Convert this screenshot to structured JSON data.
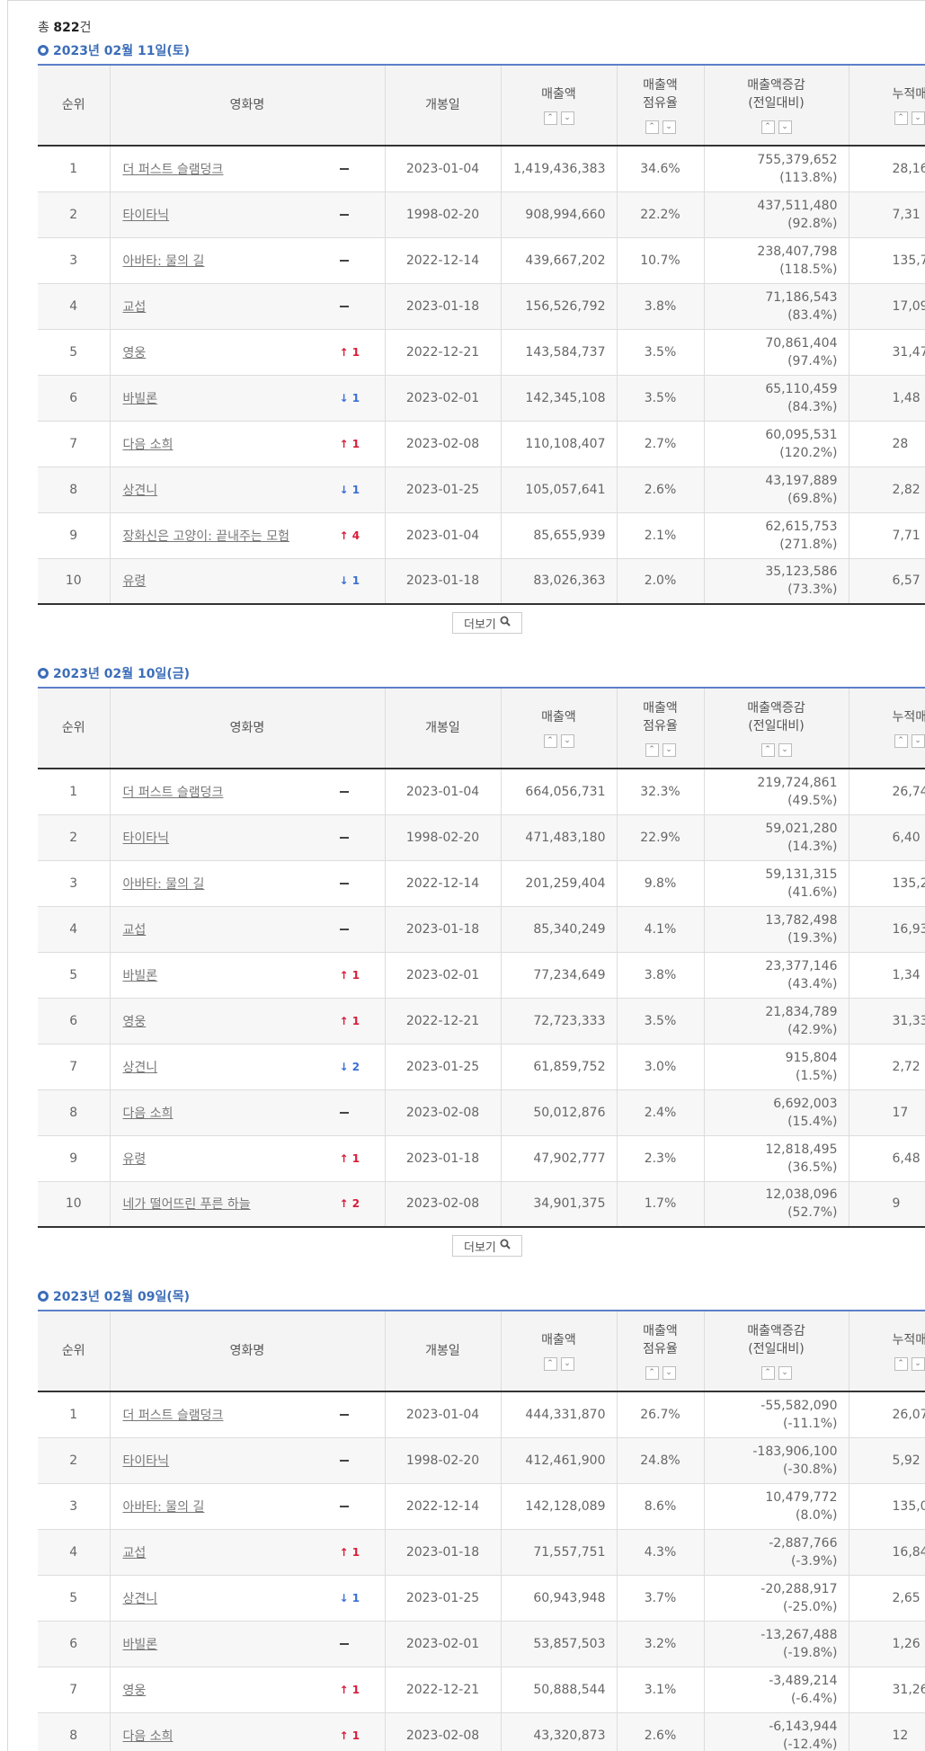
{
  "summary": {
    "prefix": "총 ",
    "count": "822",
    "suffix": "건"
  },
  "headers": {
    "rank": "순위",
    "title": "영화명",
    "opening": "개봉일",
    "sales": "매출액",
    "share_line1": "매출액",
    "share_line2": "점유율",
    "inc_line1": "매출액증감",
    "inc_line2": "(전일대비)",
    "cum": "누적매출액",
    "sort_up": "⌃",
    "sort_down": "⌄"
  },
  "more_label": "더보기",
  "days": [
    {
      "date": "2023년 02월 11일(토)",
      "rows": [
        {
          "rank": "1",
          "title": "더 퍼스트 슬램덩크",
          "change_dir": "same",
          "change_val": "",
          "open": "2023-01-04",
          "sales": "1,419,436,383",
          "share": "34.6%",
          "inc": "755,379,652",
          "inc_pct": "(113.8%)",
          "cum": "28,16"
        },
        {
          "rank": "2",
          "title": "타이타닉",
          "change_dir": "same",
          "change_val": "",
          "open": "1998-02-20",
          "sales": "908,994,660",
          "share": "22.2%",
          "inc": "437,511,480",
          "inc_pct": "(92.8%)",
          "cum": "7,31"
        },
        {
          "rank": "3",
          "title": "아바타: 물의 길",
          "change_dir": "same",
          "change_val": "",
          "open": "2022-12-14",
          "sales": "439,667,202",
          "share": "10.7%",
          "inc": "238,407,798",
          "inc_pct": "(118.5%)",
          "cum": "135,73"
        },
        {
          "rank": "4",
          "title": "교섭",
          "change_dir": "same",
          "change_val": "",
          "open": "2023-01-18",
          "sales": "156,526,792",
          "share": "3.8%",
          "inc": "71,186,543",
          "inc_pct": "(83.4%)",
          "cum": "17,09"
        },
        {
          "rank": "5",
          "title": "영웅",
          "change_dir": "up",
          "change_val": "1",
          "open": "2022-12-21",
          "sales": "143,584,737",
          "share": "3.5%",
          "inc": "70,861,404",
          "inc_pct": "(97.4%)",
          "cum": "31,47"
        },
        {
          "rank": "6",
          "title": "바빌론",
          "change_dir": "down",
          "change_val": "1",
          "open": "2023-02-01",
          "sales": "142,345,108",
          "share": "3.5%",
          "inc": "65,110,459",
          "inc_pct": "(84.3%)",
          "cum": "1,48"
        },
        {
          "rank": "7",
          "title": "다음 소희",
          "change_dir": "up",
          "change_val": "1",
          "open": "2023-02-08",
          "sales": "110,108,407",
          "share": "2.7%",
          "inc": "60,095,531",
          "inc_pct": "(120.2%)",
          "cum": "28"
        },
        {
          "rank": "8",
          "title": "상견니",
          "change_dir": "down",
          "change_val": "1",
          "open": "2023-01-25",
          "sales": "105,057,641",
          "share": "2.6%",
          "inc": "43,197,889",
          "inc_pct": "(69.8%)",
          "cum": "2,82"
        },
        {
          "rank": "9",
          "title": "장화신은 고양이: 끝내주는 모험",
          "change_dir": "up",
          "change_val": "4",
          "open": "2023-01-04",
          "sales": "85,655,939",
          "share": "2.1%",
          "inc": "62,615,753",
          "inc_pct": "(271.8%)",
          "cum": "7,71"
        },
        {
          "rank": "10",
          "title": "유령",
          "change_dir": "down",
          "change_val": "1",
          "open": "2023-01-18",
          "sales": "83,026,363",
          "share": "2.0%",
          "inc": "35,123,586",
          "inc_pct": "(73.3%)",
          "cum": "6,57"
        }
      ]
    },
    {
      "date": "2023년 02월 10일(금)",
      "rows": [
        {
          "rank": "1",
          "title": "더 퍼스트 슬램덩크",
          "change_dir": "same",
          "change_val": "",
          "open": "2023-01-04",
          "sales": "664,056,731",
          "share": "32.3%",
          "inc": "219,724,861",
          "inc_pct": "(49.5%)",
          "cum": "26,74"
        },
        {
          "rank": "2",
          "title": "타이타닉",
          "change_dir": "same",
          "change_val": "",
          "open": "1998-02-20",
          "sales": "471,483,180",
          "share": "22.9%",
          "inc": "59,021,280",
          "inc_pct": "(14.3%)",
          "cum": "6,40"
        },
        {
          "rank": "3",
          "title": "아바타: 물의 길",
          "change_dir": "same",
          "change_val": "",
          "open": "2022-12-14",
          "sales": "201,259,404",
          "share": "9.8%",
          "inc": "59,131,315",
          "inc_pct": "(41.6%)",
          "cum": "135,29"
        },
        {
          "rank": "4",
          "title": "교섭",
          "change_dir": "same",
          "change_val": "",
          "open": "2023-01-18",
          "sales": "85,340,249",
          "share": "4.1%",
          "inc": "13,782,498",
          "inc_pct": "(19.3%)",
          "cum": "16,93"
        },
        {
          "rank": "5",
          "title": "바빌론",
          "change_dir": "up",
          "change_val": "1",
          "open": "2023-02-01",
          "sales": "77,234,649",
          "share": "3.8%",
          "inc": "23,377,146",
          "inc_pct": "(43.4%)",
          "cum": "1,34"
        },
        {
          "rank": "6",
          "title": "영웅",
          "change_dir": "up",
          "change_val": "1",
          "open": "2022-12-21",
          "sales": "72,723,333",
          "share": "3.5%",
          "inc": "21,834,789",
          "inc_pct": "(42.9%)",
          "cum": "31,33"
        },
        {
          "rank": "7",
          "title": "상견니",
          "change_dir": "down",
          "change_val": "2",
          "open": "2023-01-25",
          "sales": "61,859,752",
          "share": "3.0%",
          "inc": "915,804",
          "inc_pct": "(1.5%)",
          "cum": "2,72"
        },
        {
          "rank": "8",
          "title": "다음 소희",
          "change_dir": "same",
          "change_val": "",
          "open": "2023-02-08",
          "sales": "50,012,876",
          "share": "2.4%",
          "inc": "6,692,003",
          "inc_pct": "(15.4%)",
          "cum": "17"
        },
        {
          "rank": "9",
          "title": "유령",
          "change_dir": "up",
          "change_val": "1",
          "open": "2023-01-18",
          "sales": "47,902,777",
          "share": "2.3%",
          "inc": "12,818,495",
          "inc_pct": "(36.5%)",
          "cum": "6,48"
        },
        {
          "rank": "10",
          "title": "네가 떨어뜨린 푸른 하늘",
          "change_dir": "up",
          "change_val": "2",
          "open": "2023-02-08",
          "sales": "34,901,375",
          "share": "1.7%",
          "inc": "12,038,096",
          "inc_pct": "(52.7%)",
          "cum": "9"
        }
      ]
    },
    {
      "date": "2023년 02월 09일(목)",
      "rows": [
        {
          "rank": "1",
          "title": "더 퍼스트 슬램덩크",
          "change_dir": "same",
          "change_val": "",
          "open": "2023-01-04",
          "sales": "444,331,870",
          "share": "26.7%",
          "inc": "-55,582,090",
          "inc_pct": "(-11.1%)",
          "cum": "26,07"
        },
        {
          "rank": "2",
          "title": "타이타닉",
          "change_dir": "same",
          "change_val": "",
          "open": "1998-02-20",
          "sales": "412,461,900",
          "share": "24.8%",
          "inc": "-183,906,100",
          "inc_pct": "(-30.8%)",
          "cum": "5,92"
        },
        {
          "rank": "3",
          "title": "아바타: 물의 길",
          "change_dir": "same",
          "change_val": "",
          "open": "2022-12-14",
          "sales": "142,128,089",
          "share": "8.6%",
          "inc": "10,479,772",
          "inc_pct": "(8.0%)",
          "cum": "135,09"
        },
        {
          "rank": "4",
          "title": "교섭",
          "change_dir": "up",
          "change_val": "1",
          "open": "2023-01-18",
          "sales": "71,557,751",
          "share": "4.3%",
          "inc": "-2,887,766",
          "inc_pct": "(-3.9%)",
          "cum": "16,84"
        },
        {
          "rank": "5",
          "title": "상견니",
          "change_dir": "down",
          "change_val": "1",
          "open": "2023-01-25",
          "sales": "60,943,948",
          "share": "3.7%",
          "inc": "-20,288,917",
          "inc_pct": "(-25.0%)",
          "cum": "2,65"
        },
        {
          "rank": "6",
          "title": "바빌론",
          "change_dir": "same",
          "change_val": "",
          "open": "2023-02-01",
          "sales": "53,857,503",
          "share": "3.2%",
          "inc": "-13,267,488",
          "inc_pct": "(-19.8%)",
          "cum": "1,26"
        },
        {
          "rank": "7",
          "title": "영웅",
          "change_dir": "up",
          "change_val": "1",
          "open": "2022-12-21",
          "sales": "50,888,544",
          "share": "3.1%",
          "inc": "-3,489,214",
          "inc_pct": "(-6.4%)",
          "cum": "31,26"
        },
        {
          "rank": "8",
          "title": "다음 소희",
          "change_dir": "up",
          "change_val": "1",
          "open": "2023-02-08",
          "sales": "43,320,873",
          "share": "2.6%",
          "inc": "-6,143,944",
          "inc_pct": "(-12.4%)",
          "cum": "12"
        }
      ]
    }
  ]
}
